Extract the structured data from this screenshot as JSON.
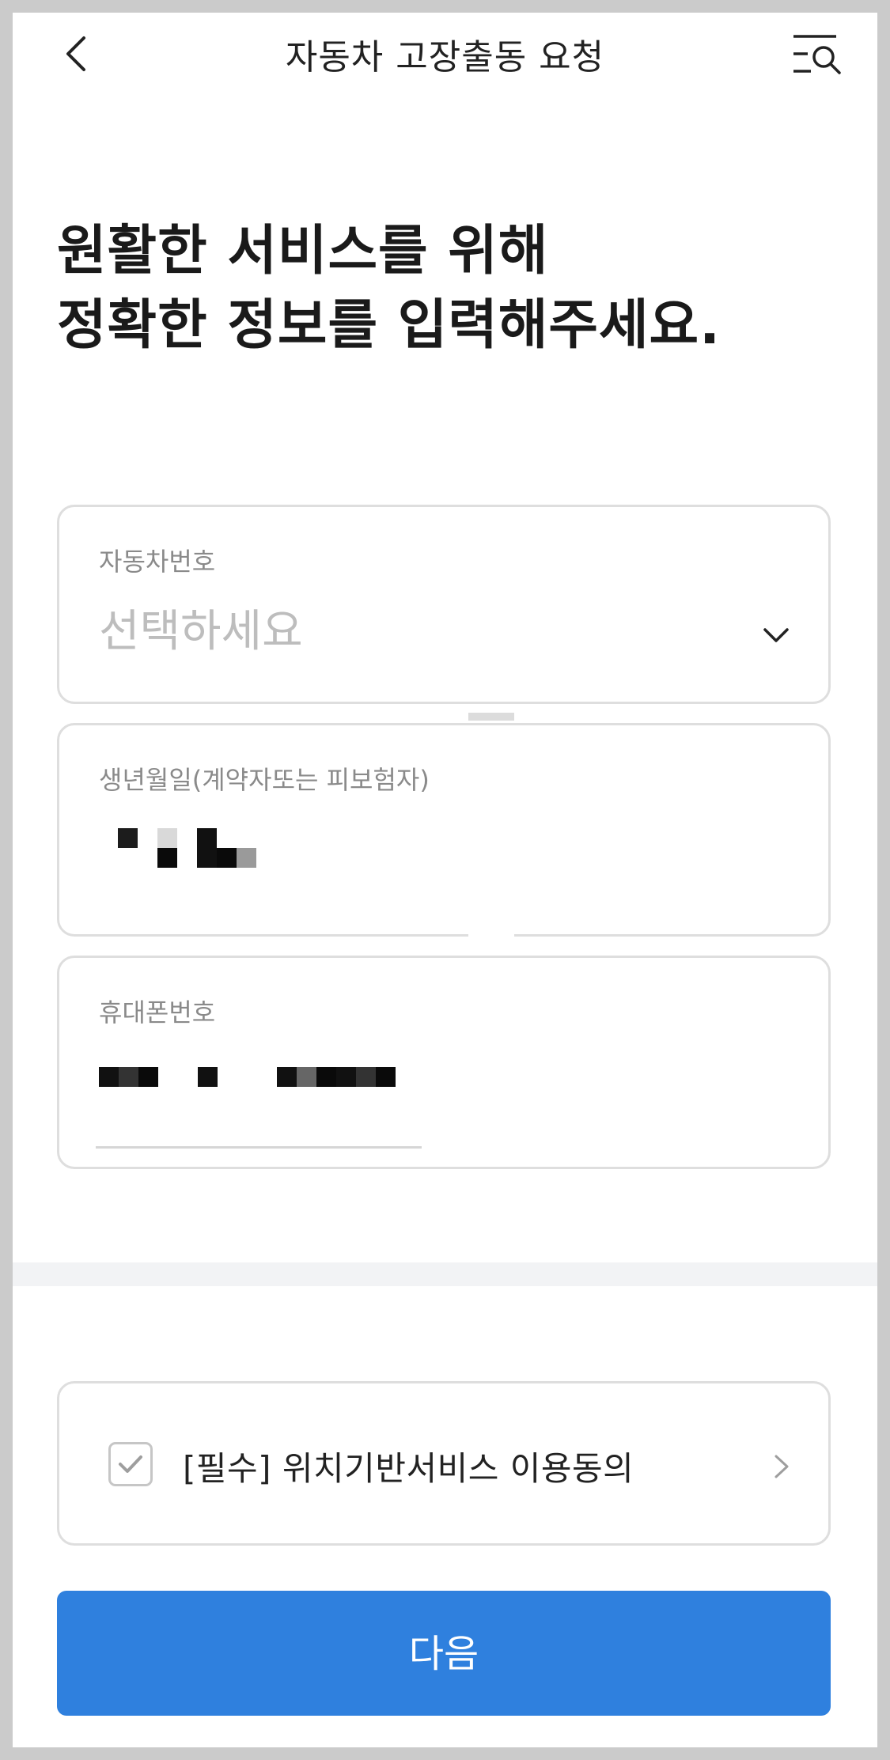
{
  "header": {
    "title": "자동차 고장출동 요청",
    "back_icon": "chevron-left-icon",
    "menu_icon": "menu-search-icon"
  },
  "headline": {
    "line1": "원활한 서비스를 위해",
    "line2": "정확한 정보를 입력해주세요."
  },
  "form": {
    "car_number": {
      "label": "자동차번호",
      "placeholder": "선택하세요",
      "icon": "chevron-down-icon"
    },
    "birth_date": {
      "label": "생년월일(계약자또는 피보험자)"
    },
    "phone": {
      "label": "휴대폰번호"
    }
  },
  "consent": {
    "label": "[필수] 위치기반서비스 이용동의",
    "checked": true,
    "icon": "chevron-right-icon"
  },
  "next_button": {
    "label": "다음"
  },
  "colors": {
    "primary": "#2f80de",
    "border": "#dedede",
    "placeholder": "#bdbdbd",
    "label": "#8a8a8a"
  }
}
